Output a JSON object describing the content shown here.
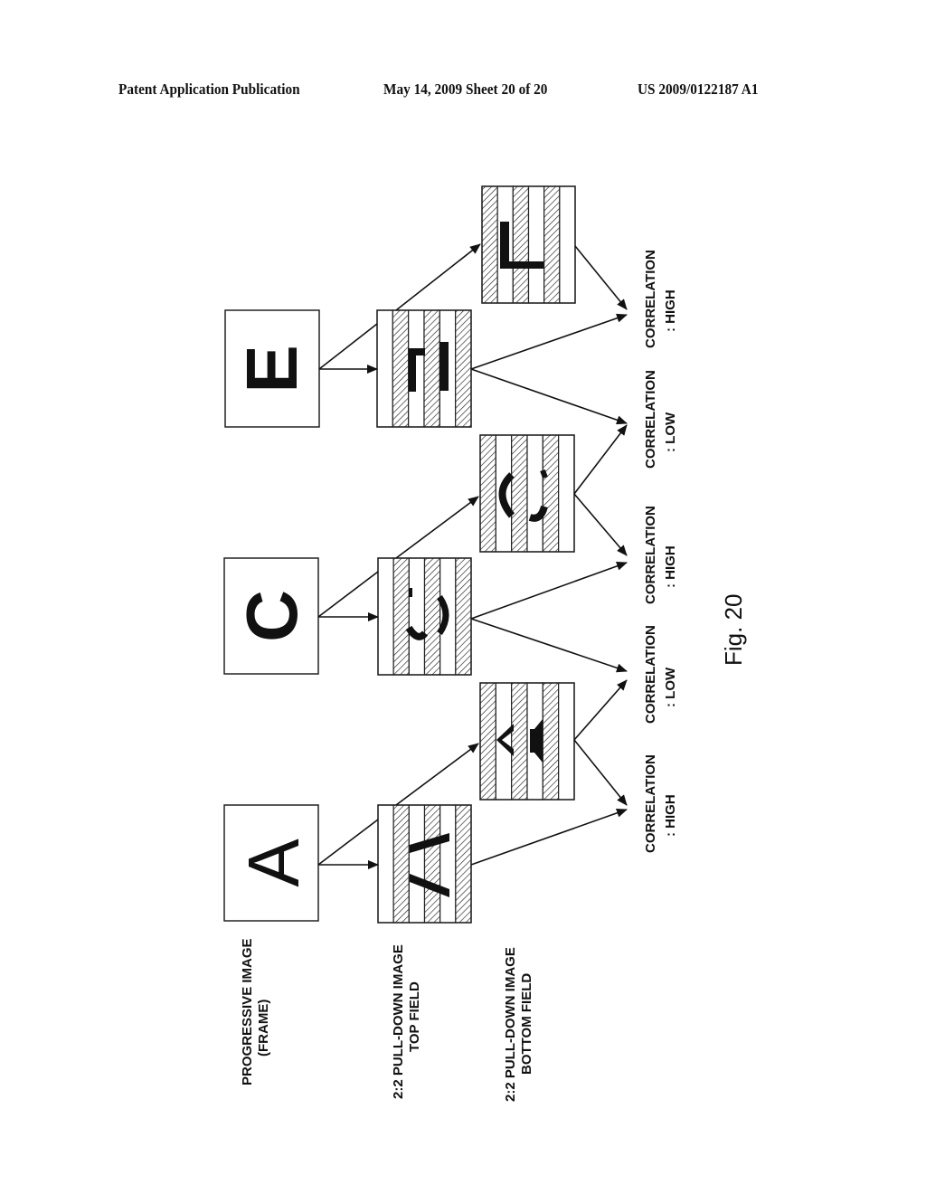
{
  "header": {
    "left": "Patent Application Publication",
    "middle": "May 14, 2009  Sheet 20 of 20",
    "right": "US 2009/0122187 A1"
  },
  "row_labels": {
    "progressive": [
      "PROGRESSIVE IMAGE",
      "(FRAME)"
    ],
    "top_field": [
      "2:2 PULL-DOWN IMAGE",
      "TOP FIELD"
    ],
    "bottom_field": [
      "2:2 PULL-DOWN IMAGE",
      "BOTTOM FIELD"
    ]
  },
  "frames": [
    {
      "letter": "A"
    },
    {
      "letter": "C"
    },
    {
      "letter": "E"
    }
  ],
  "correlations": [
    {
      "title": "CORRELATION",
      "value": ": HIGH"
    },
    {
      "title": "CORRELATION",
      "value": ": LOW"
    },
    {
      "title": "CORRELATION",
      "value": ": HIGH"
    },
    {
      "title": "CORRELATION",
      "value": ": LOW"
    },
    {
      "title": "CORRELATION",
      "value": ": HIGH"
    }
  ],
  "figure_label": "Fig. 20",
  "colors": {
    "ink": "#111111",
    "paper": "#ffffff"
  }
}
